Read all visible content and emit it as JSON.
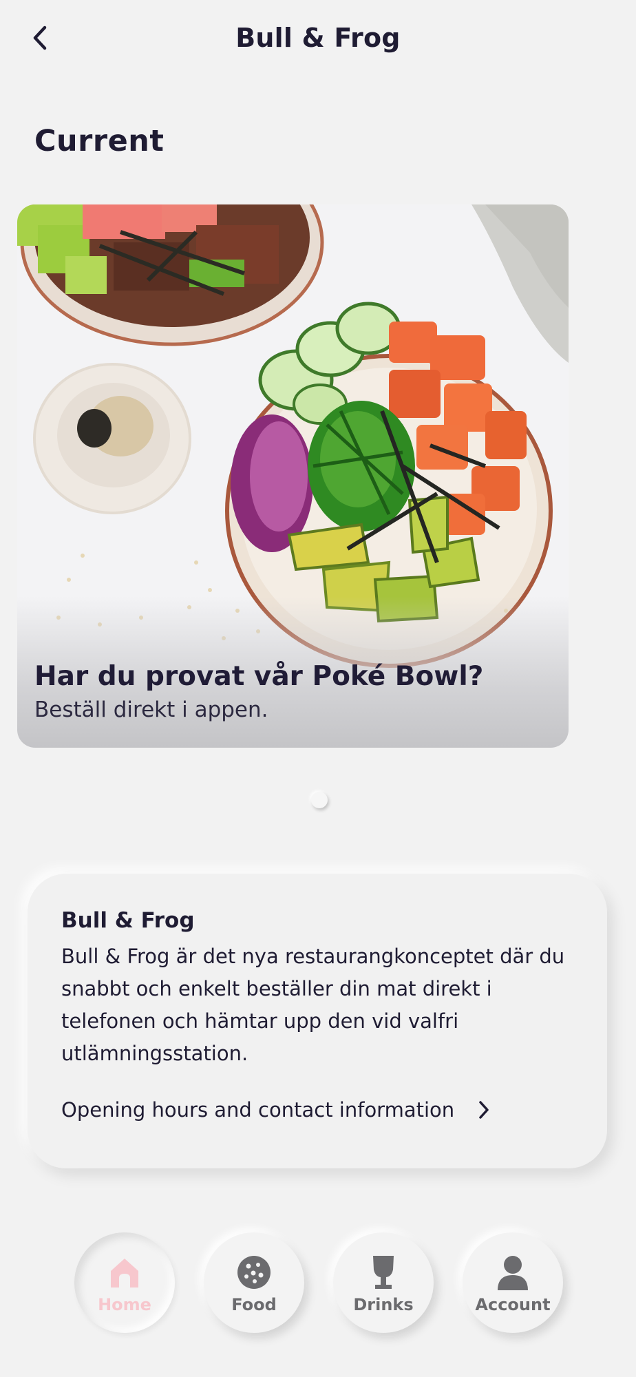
{
  "header": {
    "title": "Bull & Frog",
    "back_icon": "chevron-left-icon"
  },
  "current": {
    "section_title": "Current",
    "hero": {
      "title": "Har du provat vår Poké Bowl?",
      "subtitle": "Beställ direkt i appen.",
      "image": "poke-bowl-photo"
    },
    "pager": {
      "page": 1,
      "count": 1
    }
  },
  "info": {
    "title": "Bull & Frog",
    "body": "Bull & Frog är det nya restaurangkonceptet där du snabbt och enkelt beställer din mat direkt i telefonen och hämtar upp den vid valfri utlämningsstation.",
    "link_label": "Opening hours and contact information",
    "link_icon": "chevron-right-icon"
  },
  "nav": {
    "items": [
      {
        "label": "Home",
        "icon": "home-icon",
        "active": true
      },
      {
        "label": "Food",
        "icon": "cookie-icon",
        "active": false
      },
      {
        "label": "Drinks",
        "icon": "glass-icon",
        "active": false
      },
      {
        "label": "Account",
        "icon": "person-icon",
        "active": false
      }
    ]
  },
  "colors": {
    "background": "#f2f2f2",
    "text": "#1f1c33",
    "nav_inactive": "#6b6b6e",
    "nav_active": "#f7c7cd"
  }
}
